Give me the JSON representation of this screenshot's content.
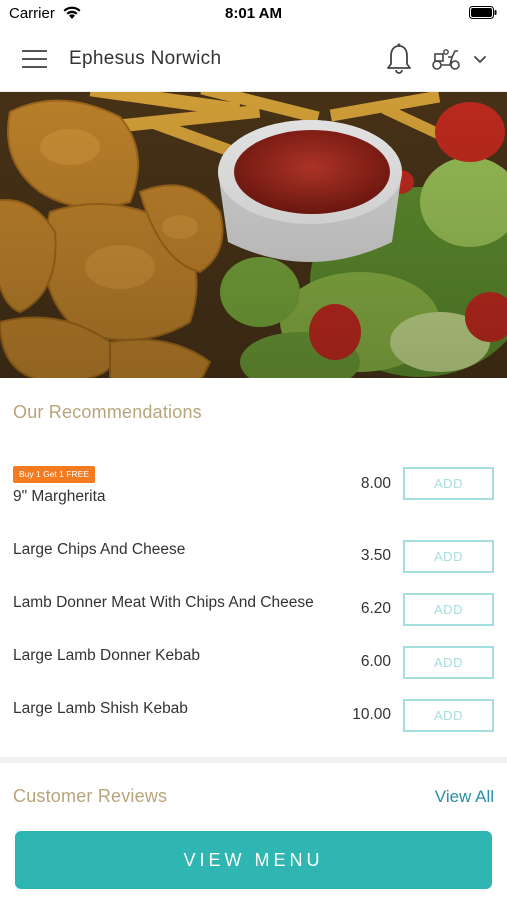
{
  "status_bar": {
    "carrier": "Carrier",
    "time": "8:01 AM",
    "icons": [
      "wifi-icon",
      "battery-icon"
    ]
  },
  "header": {
    "title": "Ephesus Norwich",
    "icons": [
      "menu-icon",
      "bell-icon",
      "scooter-icon",
      "chevron-down-icon"
    ]
  },
  "recommendations": {
    "title": "Our Recommendations",
    "items": [
      {
        "badge": "Buy 1 Get 1 FREE",
        "name": "9\" Margherita",
        "price": "8.00",
        "button": "ADD"
      },
      {
        "name": "Large Chips And Cheese",
        "price": "3.50",
        "button": "ADD"
      },
      {
        "name": "Lamb Donner Meat With Chips And Cheese",
        "price": "6.20",
        "button": "ADD"
      },
      {
        "name": "Large Lamb Donner Kebab",
        "price": "6.00",
        "button": "ADD"
      },
      {
        "name": "Large Lamb Shish Kebab",
        "price": "10.00",
        "button": "ADD"
      }
    ]
  },
  "reviews": {
    "title": "Customer Reviews",
    "view_all": "View All"
  },
  "footer": {
    "view_menu": "VIEW MENU"
  },
  "colors": {
    "accent": "#2fb6b2",
    "add_button": "#a5dede",
    "section_title": "#b8a47a",
    "badge": "#f47b20",
    "link": "#2a8fa8"
  }
}
